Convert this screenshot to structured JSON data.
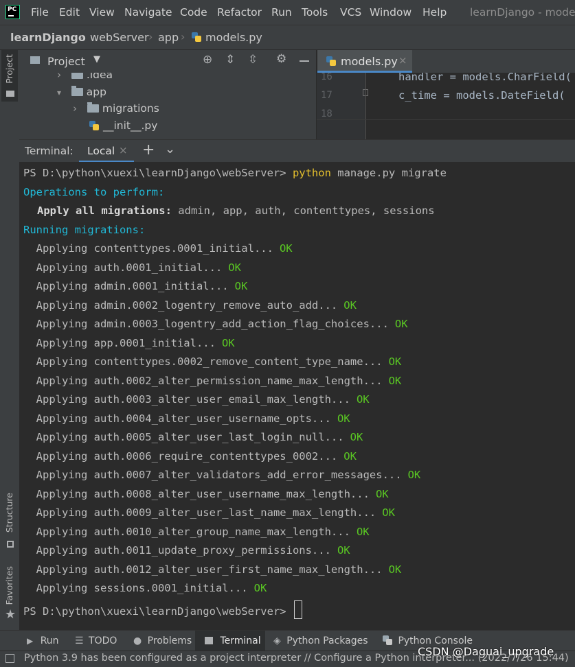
{
  "menubar": {
    "logo_text": "PC",
    "items": [
      "File",
      "Edit",
      "View",
      "Navigate",
      "Code",
      "Refactor",
      "Run",
      "Tools",
      "VCS",
      "Window",
      "Help"
    ],
    "window_title": "learnDjango - models"
  },
  "breadcrumb": [
    "learnDjango",
    "webServer",
    "app",
    "models.py"
  ],
  "left_strip": {
    "project": "Project",
    "structure": "Structure",
    "favorites": "Favorites"
  },
  "project_panel": {
    "title": "Project",
    "tree": [
      {
        "label": ".idea",
        "type": "folder"
      },
      {
        "label": "app",
        "type": "folder"
      },
      {
        "label": "migrations",
        "type": "folder"
      },
      {
        "label": "__init__.py",
        "type": "python-file"
      }
    ]
  },
  "editor": {
    "tab_label": "models.py",
    "lines": [
      {
        "num": "16",
        "code": "handler = models.CharField("
      },
      {
        "num": "17",
        "code": "c_time = models.DateField("
      },
      {
        "num": "18",
        "code": ""
      }
    ]
  },
  "terminal": {
    "label": "Terminal:",
    "tab": "Local",
    "prompt": "PS D:\\python\\xuexi\\learnDjango\\webServer> ",
    "command_keyword": "python",
    "command_args": " manage.py migrate",
    "ops_header": "Operations to perform:",
    "apply_all_label": "Apply all migrations:",
    "apply_all_apps": " admin, app, auth, contenttypes, sessions",
    "running_header": "Running migrations:",
    "applying_prefix": "  Applying ",
    "ok": "OK",
    "migrations": [
      "contenttypes.0001_initial...",
      "auth.0001_initial...",
      "admin.0001_initial...",
      "admin.0002_logentry_remove_auto_add...",
      "admin.0003_logentry_add_action_flag_choices...",
      "app.0001_initial...",
      "contenttypes.0002_remove_content_type_name...",
      "auth.0002_alter_permission_name_max_length...",
      "auth.0003_alter_user_email_max_length...",
      "auth.0004_alter_user_username_opts...",
      "auth.0005_alter_user_last_login_null...",
      "auth.0006_require_contenttypes_0002...",
      "auth.0007_alter_validators_add_error_messages...",
      "auth.0008_alter_user_username_max_length...",
      "auth.0009_alter_user_last_name_max_length...",
      "auth.0010_alter_group_name_max_length...",
      "auth.0011_update_proxy_permissions...",
      "auth.0012_alter_user_first_name_max_length...",
      "sessions.0001_initial..."
    ],
    "final_prompt": "PS D:\\python\\xuexi\\learnDjango\\webServer> "
  },
  "toolwindows": {
    "run": "Run",
    "todo": "TODO",
    "problems": "Problems",
    "terminal": "Terminal",
    "python_packages": "Python Packages",
    "python_console": "Python Console"
  },
  "statusbar": {
    "text": "Python 3.9 has been configured as a project interpreter // Configure a Python interpreter... (2022/7/26 15:44)"
  },
  "watermark": "CSDN @Daguai_upgrade"
}
